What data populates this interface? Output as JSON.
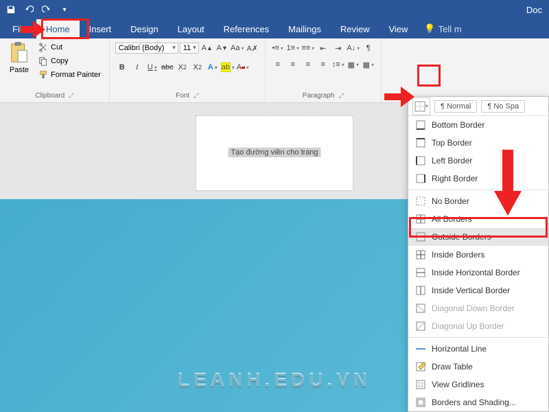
{
  "titlebar": {
    "doc": "Doc"
  },
  "tabs": {
    "file": "File",
    "home": "Home",
    "insert": "Insert",
    "design": "Design",
    "layout": "Layout",
    "references": "References",
    "mailings": "Mailings",
    "review": "Review",
    "view": "View",
    "tellme": "Tell m"
  },
  "clipboard": {
    "paste": "Paste",
    "cut": "Cut",
    "copy": "Copy",
    "format_painter": "Format Painter",
    "label": "Clipboard"
  },
  "font": {
    "name": "Calibri (Body)",
    "size": "11",
    "b": "B",
    "i": "I",
    "u": "U",
    "abc": "abc",
    "label": "Font"
  },
  "paragraph": {
    "label": "Paragraph"
  },
  "styles": {
    "normal": "¶ Normal",
    "nospacing": "¶ No Spa"
  },
  "page_text": "Tạo đường viền cho trang",
  "borders_menu": {
    "bottom": "Bottom Border",
    "top": "Top Border",
    "left": "Left Border",
    "right": "Right Border",
    "none": "No Border",
    "all": "All Borders",
    "outside": "Outside Borders",
    "inside": "Inside Borders",
    "inside_h": "Inside Horizontal Border",
    "inside_v": "Inside Vertical Border",
    "diag_down": "Diagonal Down Border",
    "diag_up": "Diagonal Up Border",
    "hline": "Horizontal Line",
    "draw": "Draw Table",
    "gridlines": "View Gridlines",
    "shading": "Borders and Shading..."
  },
  "watermark": "LEANH.EDU.VN"
}
